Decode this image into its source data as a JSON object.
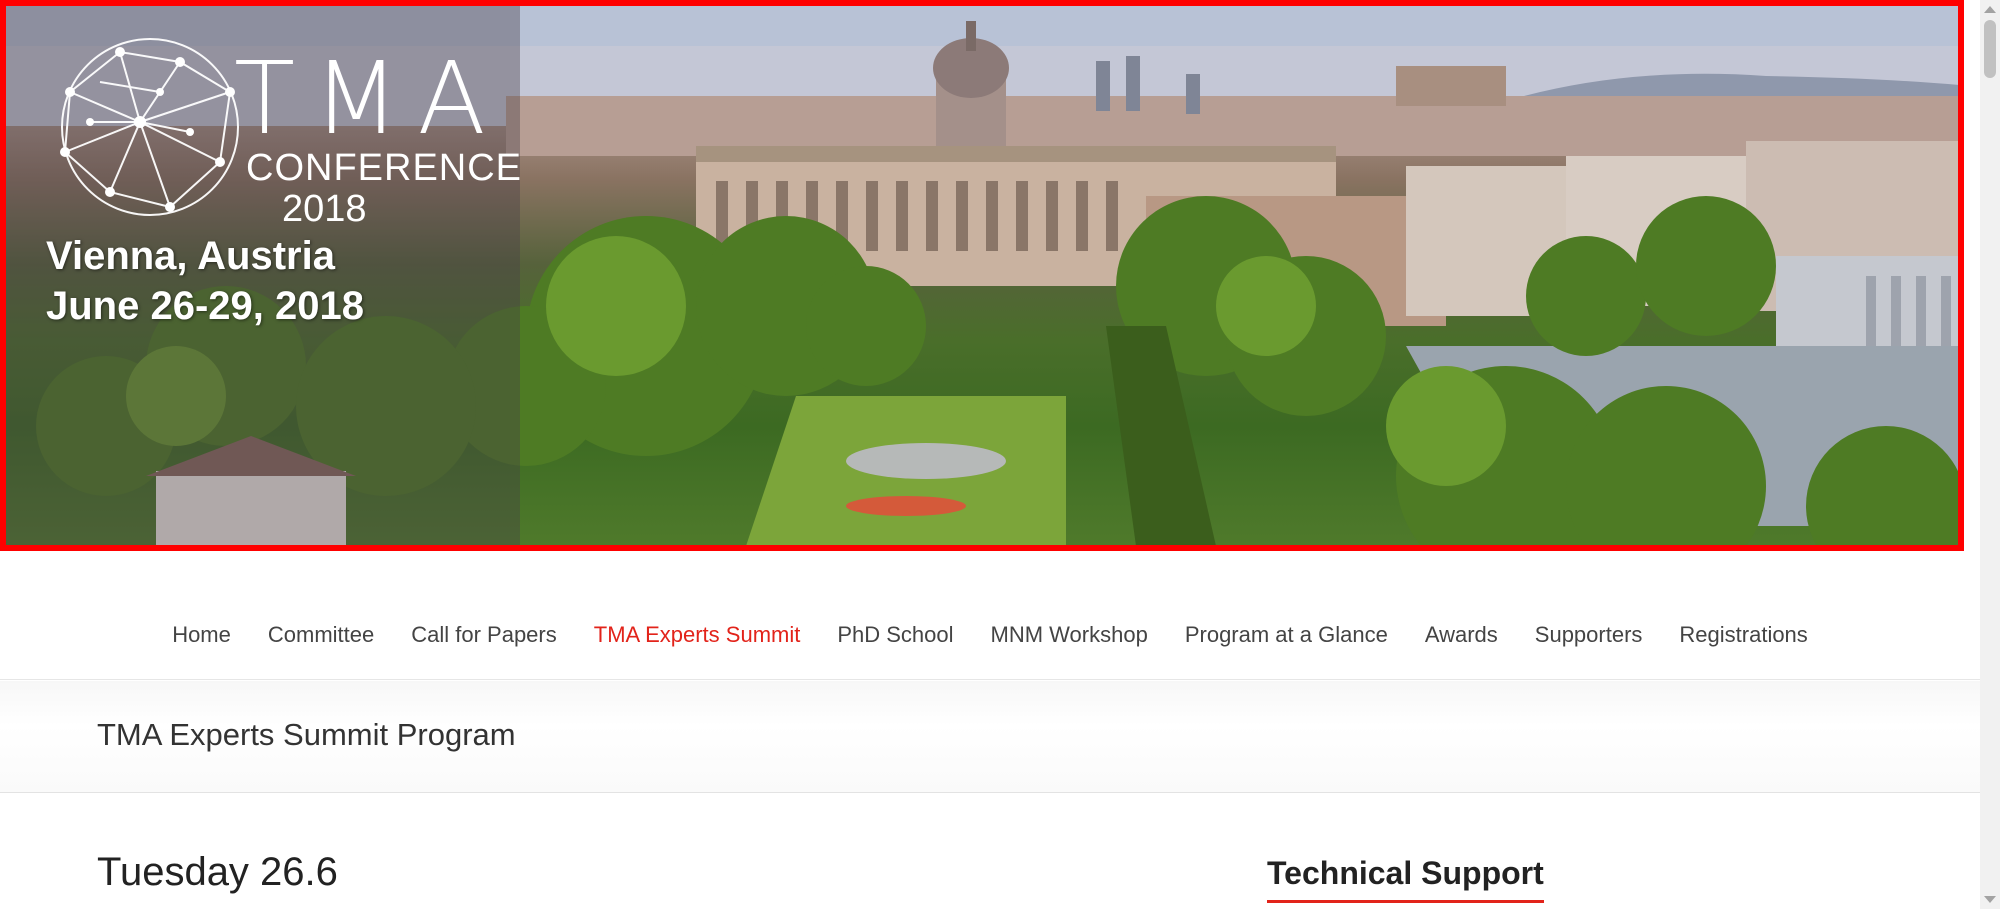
{
  "banner": {
    "logo_text": "TMA",
    "logo_subtitle": "CONFERENCE",
    "logo_year": "2018",
    "city": "Vienna, Austria",
    "dates": "June 26-29, 2018"
  },
  "nav": {
    "items": [
      {
        "label": "Home"
      },
      {
        "label": "Committee"
      },
      {
        "label": "Call for Papers"
      },
      {
        "label": "TMA Experts Summit",
        "active": true
      },
      {
        "label": "PhD School"
      },
      {
        "label": "MNM Workshop"
      },
      {
        "label": "Program at a Glance"
      },
      {
        "label": "Awards"
      },
      {
        "label": "Supporters"
      },
      {
        "label": "Registrations"
      }
    ]
  },
  "page": {
    "title": "TMA Experts Summit Program"
  },
  "content": {
    "day_heading": "Tuesday 26.6"
  },
  "sidebar": {
    "widget_title": "Technical Support"
  },
  "colors": {
    "accent": "#e2231a",
    "banner_border": "#ff0000"
  }
}
